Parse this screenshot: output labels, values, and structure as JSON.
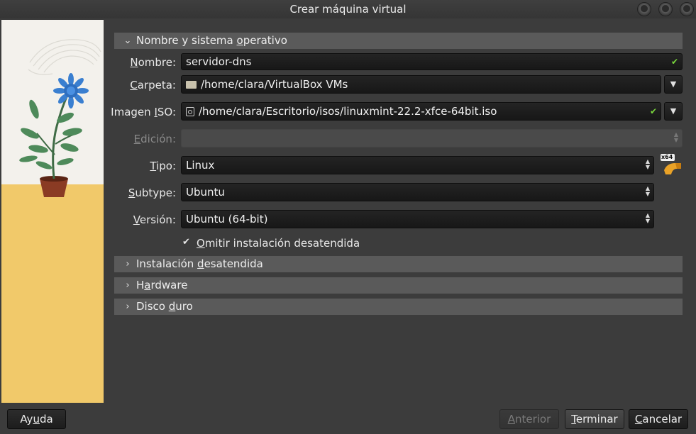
{
  "window": {
    "title": "Crear máquina virtual"
  },
  "sections": {
    "os": {
      "label_pre": "Nombre y sistema ",
      "label_u": "o",
      "label_post": "perativo",
      "state": "expanded"
    },
    "unattended": {
      "label_pre": "Instalación ",
      "label_u": "d",
      "label_post": "esatendida",
      "state": "collapsed"
    },
    "hardware": {
      "label_pre": "H",
      "label_u": "a",
      "label_post": "rdware",
      "state": "collapsed"
    },
    "disk": {
      "label_pre": "Disco ",
      "label_u": "d",
      "label_post": "uro",
      "state": "collapsed"
    }
  },
  "form": {
    "name": {
      "label_u": "N",
      "label_post": "ombre:",
      "value": "servidor-dns"
    },
    "folder": {
      "label_u": "C",
      "label_post": "arpeta:",
      "value": "/home/clara/VirtualBox VMs"
    },
    "iso": {
      "label_pre": "Imagen ",
      "label_u": "I",
      "label_post": "SO:",
      "value": "/home/clara/Escritorio/isos/linuxmint-22.2-xfce-64bit.iso"
    },
    "edition": {
      "label_u": "E",
      "label_post": "dición:",
      "value": ""
    },
    "type": {
      "label_u": "T",
      "label_post": "ipo:",
      "value": "Linux"
    },
    "subtype": {
      "label_u": "S",
      "label_post": "ubtype:",
      "value": "Ubuntu"
    },
    "version": {
      "label_u": "V",
      "label_post": "ersión:",
      "value": "Ubuntu (64-bit)"
    },
    "skip_unattended": {
      "label_u": "O",
      "label_post": "mitir instalación desatendida",
      "checked": true
    }
  },
  "os_badge": "x64",
  "footer": {
    "help": {
      "label_pre": "Ay",
      "label_u": "u",
      "label_post": "da"
    },
    "back": {
      "label_u": "A",
      "label_post": "nterior"
    },
    "finish": {
      "label_u": "T",
      "label_post": "erminar"
    },
    "cancel": {
      "label_u": "C",
      "label_post": "ancelar"
    }
  },
  "colors": {
    "valid": "#7ad83c",
    "section_bg": "#5a5a5a",
    "window_bg": "#3c3c3c",
    "sidebar_yellow": "#f1c96a"
  }
}
